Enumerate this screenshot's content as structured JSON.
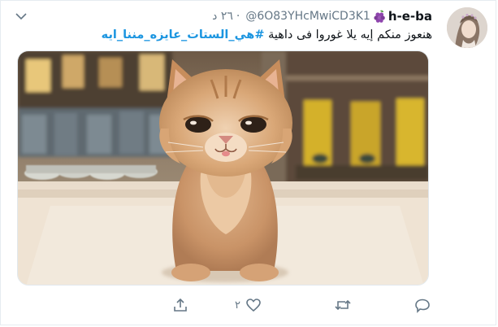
{
  "tweet": {
    "display_name": "h-e-ba",
    "display_emoji": "grape-icon",
    "handle": "@6O83YHcMwiCD3K1",
    "separator": "·",
    "time": "٢٦ د",
    "text_plain": "هنعوز منكم إيه يلا غوروا فى داهية",
    "hashtag": "#هي_الستات_عايزه_مننا_ايه",
    "image_alt": "kitten photo"
  },
  "actions": {
    "share_icon": "share-icon",
    "like_icon": "heart-icon",
    "like_count": "٢",
    "retweet_icon": "retweet-icon",
    "reply_icon": "reply-icon"
  },
  "colors": {
    "link": "#1b95e0",
    "muted": "#657786",
    "text": "#0f1419",
    "border": "#e6ecf0"
  }
}
